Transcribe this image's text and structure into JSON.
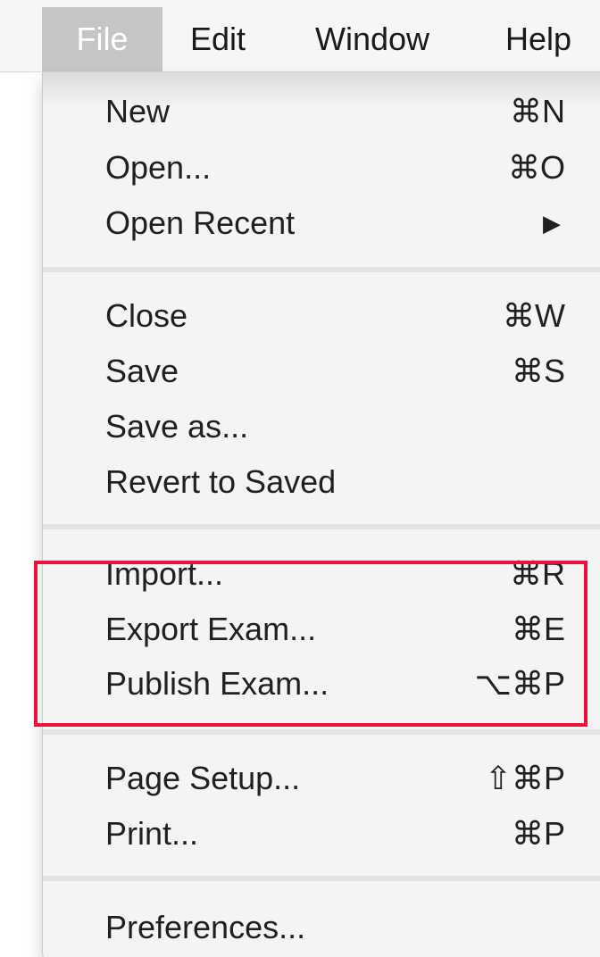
{
  "menubar": {
    "items": [
      {
        "label": "File",
        "active": true
      },
      {
        "label": "Edit",
        "active": false
      },
      {
        "label": "Window",
        "active": false
      },
      {
        "label": "Help",
        "active": false
      }
    ]
  },
  "file_menu": {
    "groups": [
      [
        {
          "label": "New",
          "shortcut": "⌘N"
        },
        {
          "label": "Open...",
          "shortcut": "⌘O"
        },
        {
          "label": "Open Recent",
          "submenu": true,
          "arrow": "▶"
        }
      ],
      [
        {
          "label": "Close",
          "shortcut": "⌘W"
        },
        {
          "label": "Save",
          "shortcut": "⌘S"
        },
        {
          "label": "Save as...",
          "shortcut": ""
        },
        {
          "label": "Revert to Saved",
          "shortcut": ""
        }
      ],
      [
        {
          "label": "Import...",
          "shortcut": "⌘R"
        },
        {
          "label": "Export Exam...",
          "shortcut": "⌘E"
        },
        {
          "label": "Publish Exam...",
          "shortcut": "⌥⌘P"
        }
      ],
      [
        {
          "label": "Page Setup...",
          "shortcut": "⇧⌘P"
        },
        {
          "label": "Print...",
          "shortcut": "⌘P"
        }
      ],
      [
        {
          "label": "Preferences...",
          "shortcut": ""
        }
      ]
    ]
  },
  "annotation": {
    "highlight_color": "#e8123c",
    "highlighted_items": [
      "Export Exam...",
      "Publish Exam..."
    ]
  },
  "colors": {
    "menu_background": "#f4f4f4",
    "menubar_background": "#f6f6f6",
    "active_menu_background": "#c4c5c7",
    "text": "#202020"
  }
}
